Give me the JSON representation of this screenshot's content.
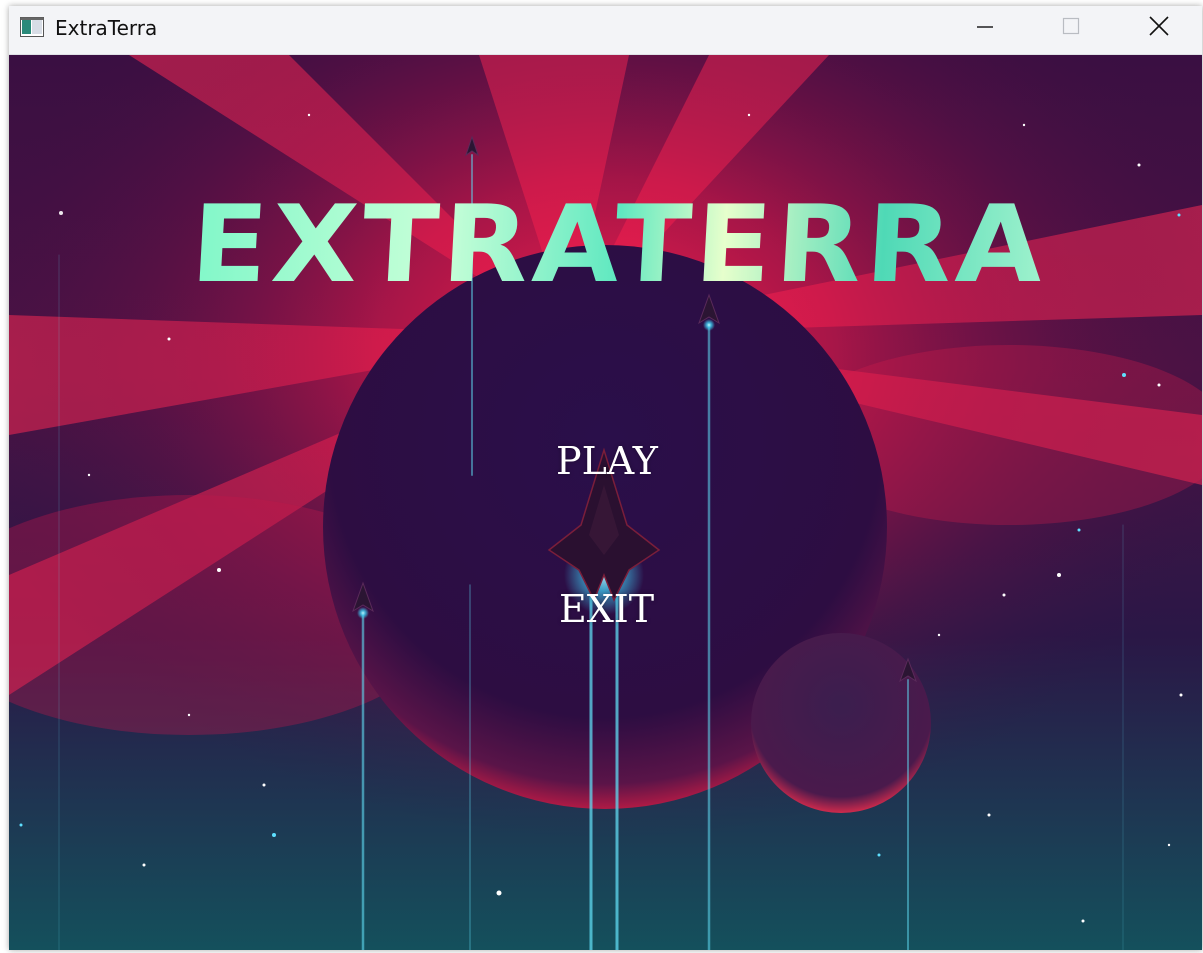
{
  "window": {
    "title": "ExtraTerra",
    "icon": "app-window-icon",
    "controls": [
      "minimize-icon",
      "maximize-icon",
      "close-icon"
    ]
  },
  "game": {
    "title": "EXTRATERRA",
    "menu": {
      "play_label": "PLAY",
      "exit_label": "EXIT"
    }
  },
  "colors": {
    "title_accent": "#6ff0c8",
    "sky_top": "#3a0f42",
    "nebula": "#ff2a55",
    "sky_bottom": "#134a56",
    "menu_text": "#ffffff"
  }
}
